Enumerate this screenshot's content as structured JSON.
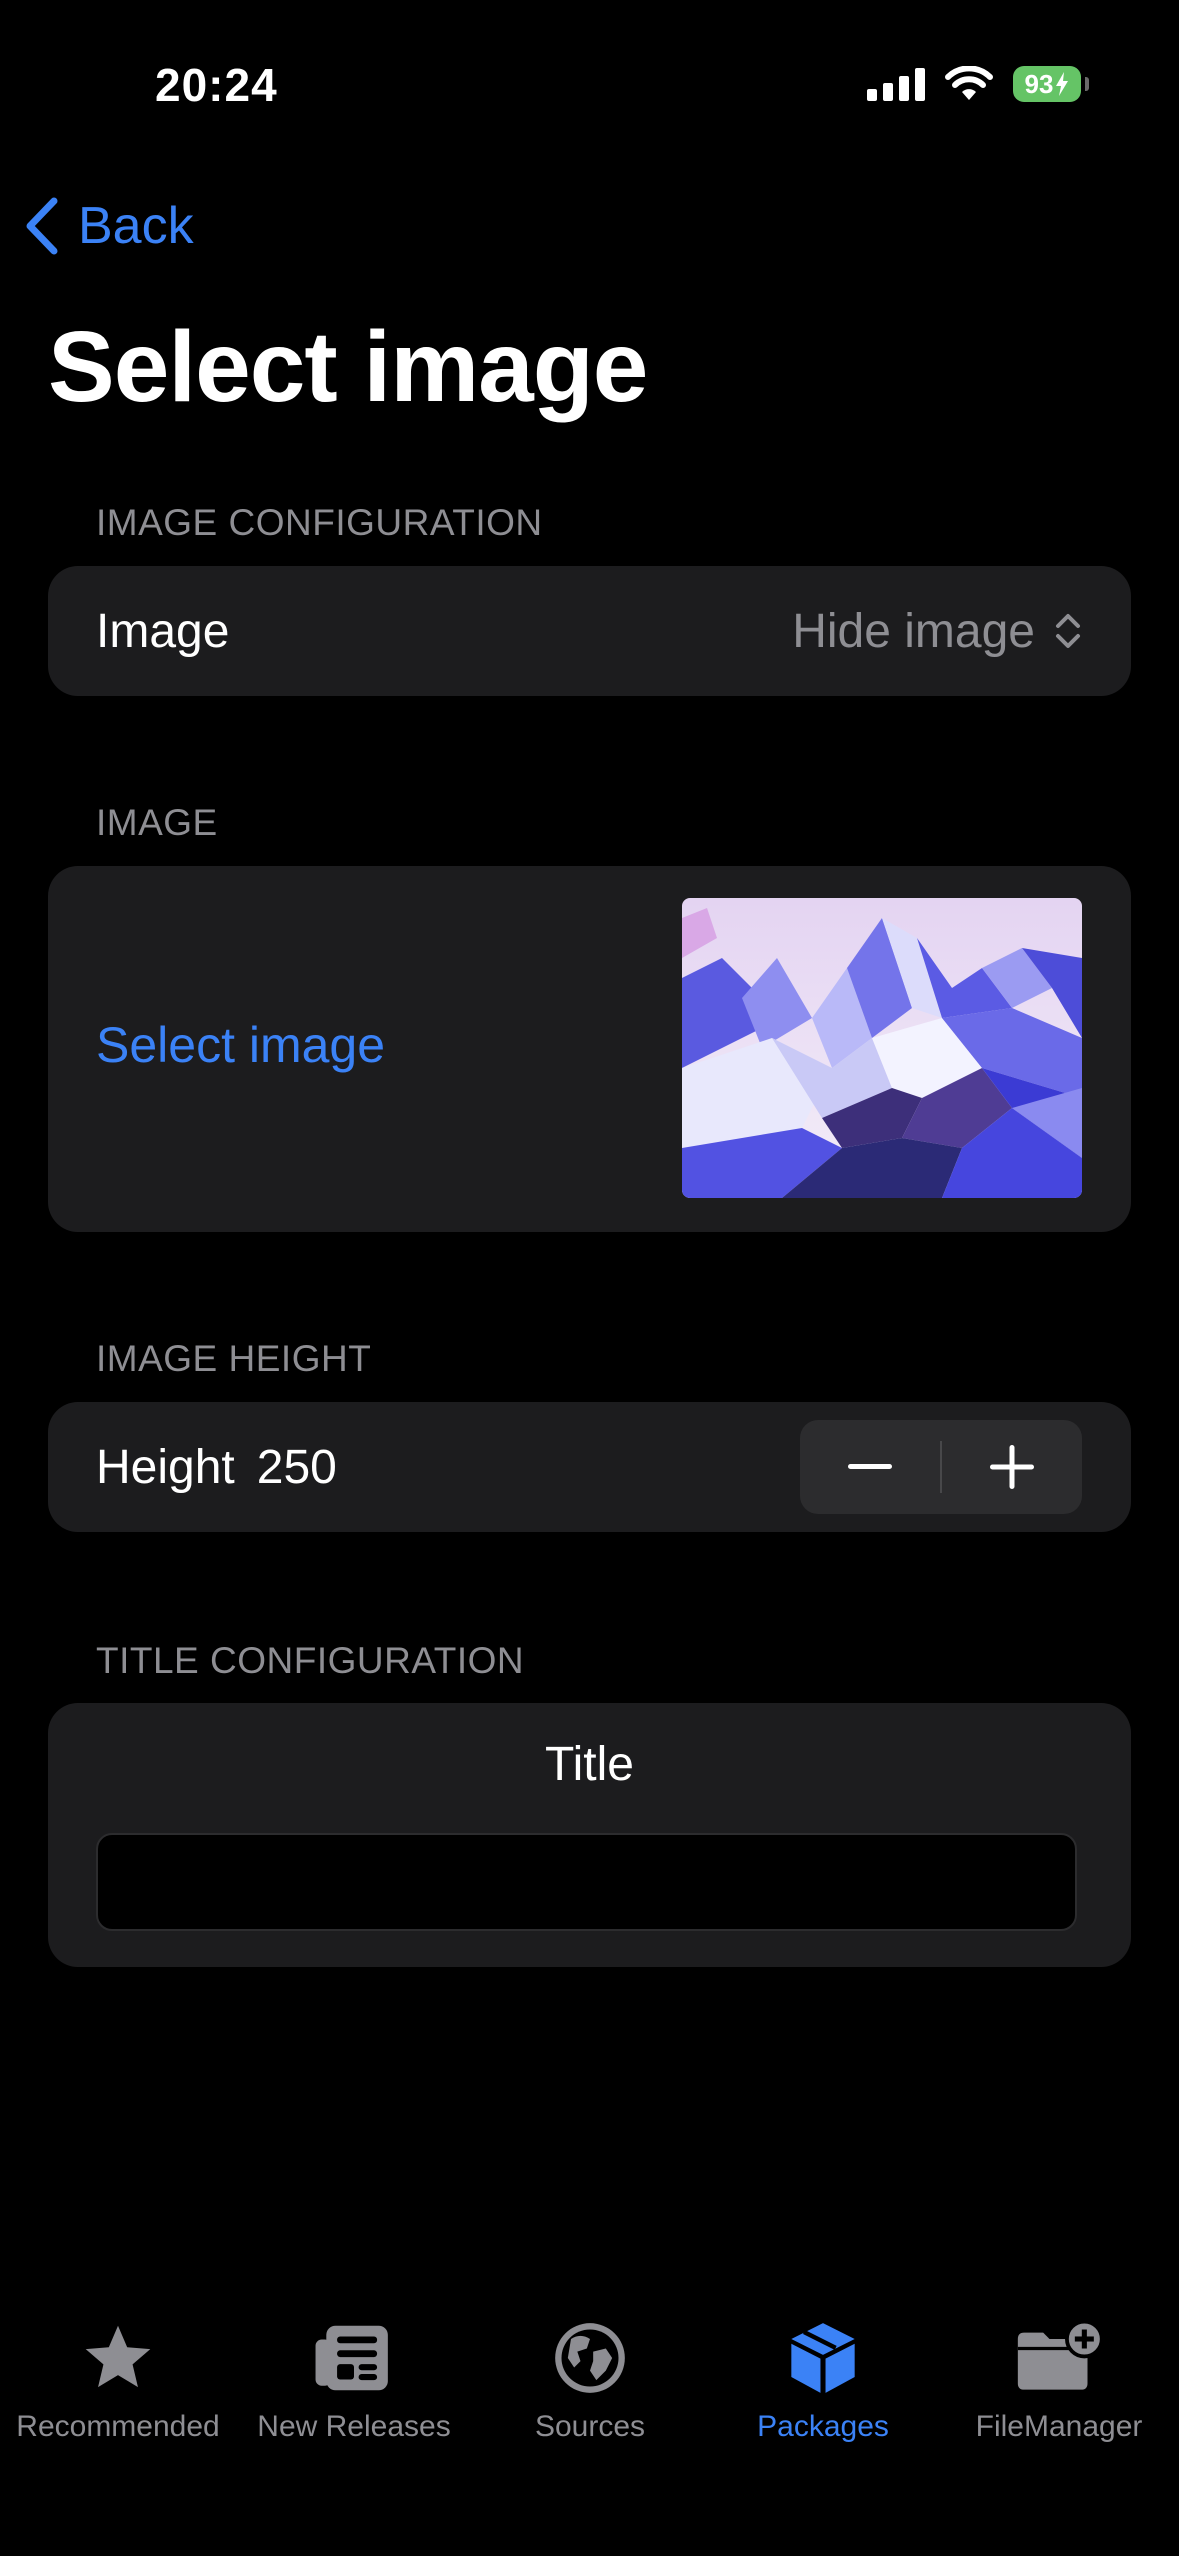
{
  "status_bar": {
    "time": "20:24",
    "battery": "93"
  },
  "nav": {
    "back_label": "Back",
    "title": "Select image"
  },
  "sections": {
    "image_config": {
      "header": "IMAGE CONFIGURATION",
      "row_label": "Image",
      "picker_value": "Hide image"
    },
    "image": {
      "header": "IMAGE",
      "select_label": "Select image"
    },
    "image_height": {
      "header": "IMAGE HEIGHT",
      "label": "Height",
      "value": "250"
    },
    "title_config": {
      "header": "TITLE CONFIGURATION",
      "title_label": "Title",
      "input_value": ""
    }
  },
  "tabbar": {
    "items": [
      {
        "label": "Recommended",
        "icon": "star-icon",
        "active": false
      },
      {
        "label": "New Releases",
        "icon": "newspaper-icon",
        "active": false
      },
      {
        "label": "Sources",
        "icon": "globe-icon",
        "active": false
      },
      {
        "label": "Packages",
        "icon": "package-icon",
        "active": true
      },
      {
        "label": "FileManager",
        "icon": "folder-add-icon",
        "active": false
      }
    ]
  },
  "colors": {
    "accent": "#3b82f6",
    "card": "#1c1c1e",
    "secondary_text": "#8e8e93",
    "battery": "#65c466"
  }
}
